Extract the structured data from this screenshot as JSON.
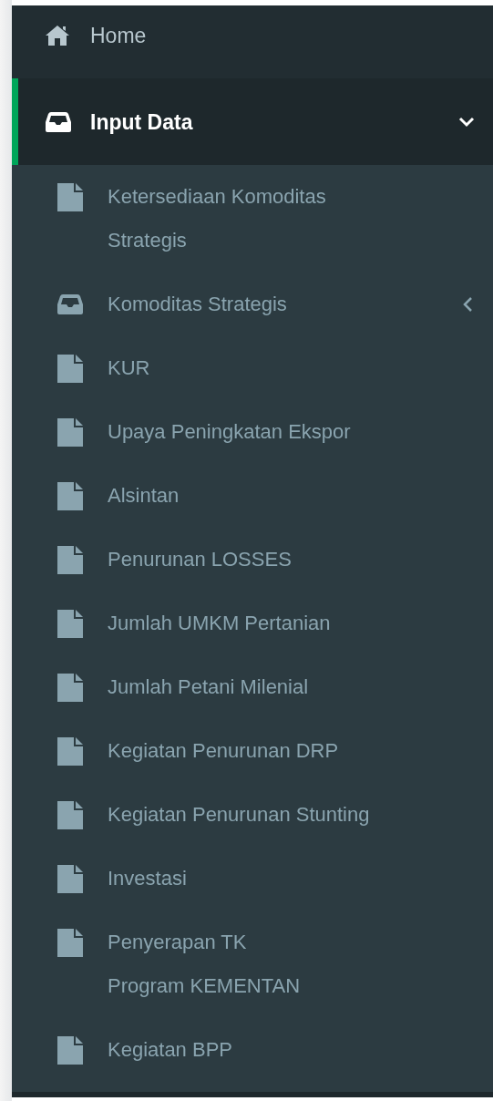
{
  "menu": [
    {
      "label": "Home",
      "selected": false
    },
    {
      "label": "Input Data",
      "selected": true,
      "expanded": true,
      "children": [
        {
          "label": "Ketersediaan Komoditas\nStrategis",
          "kind": "link"
        },
        {
          "label": "Komoditas Strategis",
          "kind": "group",
          "expanded": false
        },
        {
          "label": "KUR",
          "kind": "link"
        },
        {
          "label": "Upaya Peningkatan Ekspor",
          "kind": "link"
        },
        {
          "label": "Alsintan",
          "kind": "link"
        },
        {
          "label": "Penurunan LOSSES",
          "kind": "link"
        },
        {
          "label": "Jumlah UMKM Pertanian",
          "kind": "link"
        },
        {
          "label": "Jumlah Petani Milenial",
          "kind": "link"
        },
        {
          "label": "Kegiatan Penurunan DRP",
          "kind": "link"
        },
        {
          "label": "Kegiatan Penurunan Stunting",
          "kind": "link"
        },
        {
          "label": "Investasi",
          "kind": "link"
        },
        {
          "label": "Penyerapan TK\nProgram KEMENTAN",
          "kind": "link"
        },
        {
          "label": "Kegiatan BPP",
          "kind": "link"
        }
      ]
    }
  ]
}
